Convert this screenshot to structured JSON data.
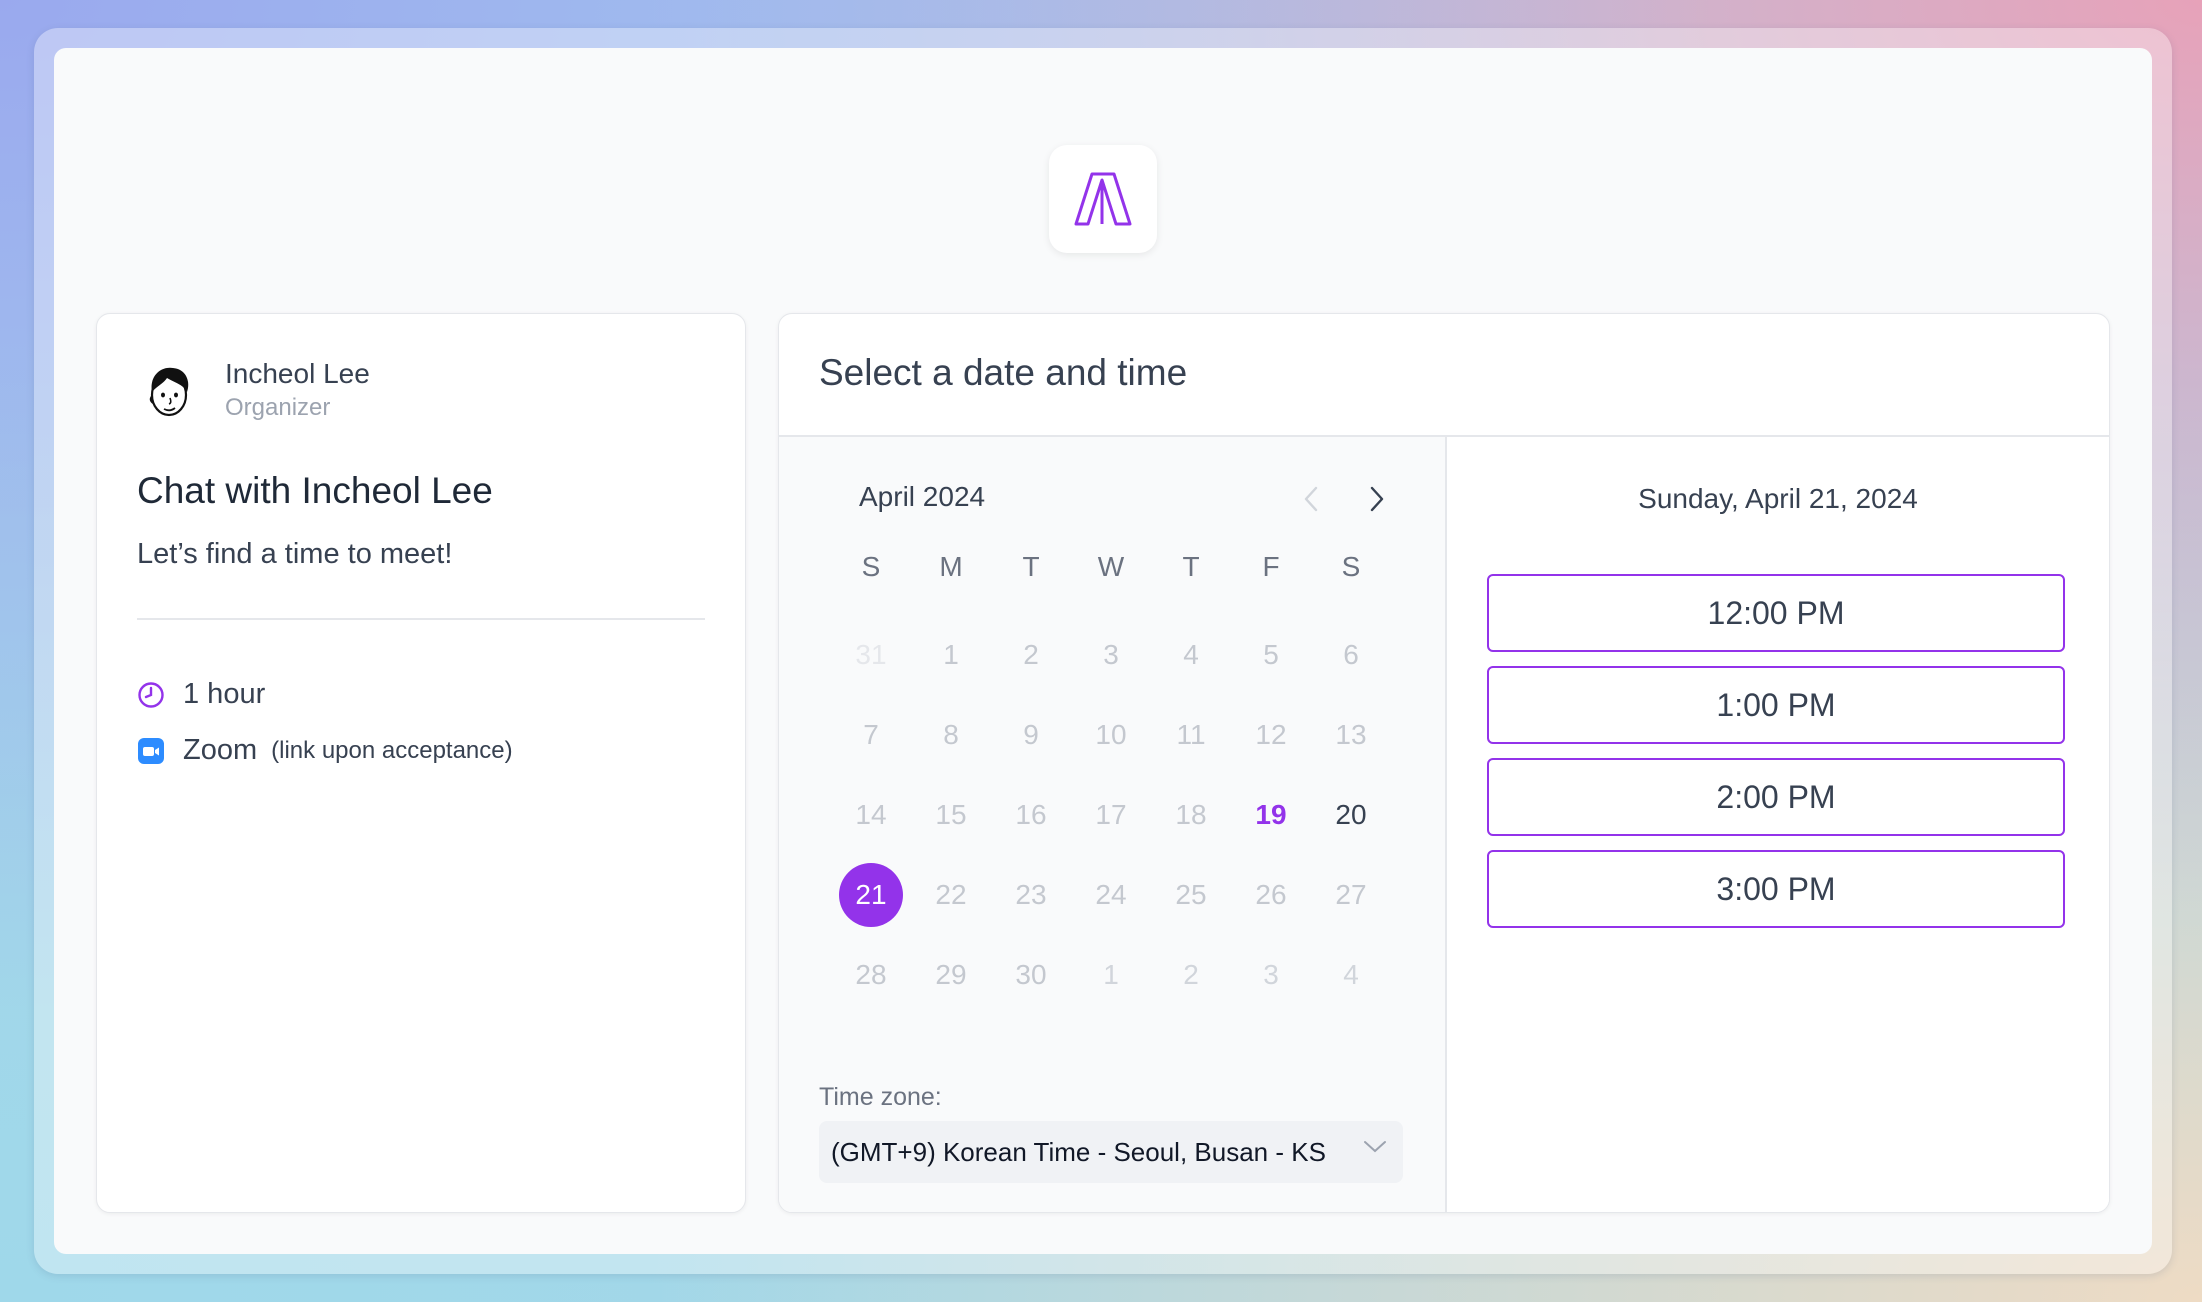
{
  "brand": {
    "accent_color": "#9333ea",
    "logo_icon": "brand-logo-icon"
  },
  "organizer": {
    "name": "Incheol Lee",
    "role": "Organizer",
    "avatar_icon": "avatar-illustration"
  },
  "event": {
    "title": "Chat with Incheol Lee",
    "description": "Let’s find a time to meet!",
    "duration": "1 hour",
    "location": "Zoom",
    "location_note": "(link upon acceptance)"
  },
  "scheduler": {
    "header": "Select a date and time",
    "month_label": "April 2024",
    "prev_icon": "chevron-left-icon",
    "next_icon": "chevron-right-icon",
    "weekdays": [
      "S",
      "M",
      "T",
      "W",
      "T",
      "F",
      "S"
    ],
    "weeks": [
      [
        {
          "d": "31",
          "s": "muted"
        },
        {
          "d": "1",
          "s": "past"
        },
        {
          "d": "2",
          "s": "past"
        },
        {
          "d": "3",
          "s": "past"
        },
        {
          "d": "4",
          "s": "past"
        },
        {
          "d": "5",
          "s": "past"
        },
        {
          "d": "6",
          "s": "past"
        }
      ],
      [
        {
          "d": "7",
          "s": "past"
        },
        {
          "d": "8",
          "s": "past"
        },
        {
          "d": "9",
          "s": "past"
        },
        {
          "d": "10",
          "s": "past"
        },
        {
          "d": "11",
          "s": "past"
        },
        {
          "d": "12",
          "s": "past"
        },
        {
          "d": "13",
          "s": "past"
        }
      ],
      [
        {
          "d": "14",
          "s": "past"
        },
        {
          "d": "15",
          "s": "past"
        },
        {
          "d": "16",
          "s": "past"
        },
        {
          "d": "17",
          "s": "past"
        },
        {
          "d": "18",
          "s": "past"
        },
        {
          "d": "19",
          "s": "today"
        },
        {
          "d": "20",
          "s": "available"
        }
      ],
      [
        {
          "d": "21",
          "s": "selected"
        },
        {
          "d": "22",
          "s": "past"
        },
        {
          "d": "23",
          "s": "past"
        },
        {
          "d": "24",
          "s": "past"
        },
        {
          "d": "25",
          "s": "past"
        },
        {
          "d": "26",
          "s": "past"
        },
        {
          "d": "27",
          "s": "past"
        }
      ],
      [
        {
          "d": "28",
          "s": "past"
        },
        {
          "d": "29",
          "s": "past"
        },
        {
          "d": "30",
          "s": "past"
        },
        {
          "d": "1",
          "s": "next-month"
        },
        {
          "d": "2",
          "s": "next-month"
        },
        {
          "d": "3",
          "s": "next-month"
        },
        {
          "d": "4",
          "s": "next-month"
        }
      ]
    ],
    "timezone_label": "Time zone:",
    "timezone_value": "(GMT+9) Korean Time - Seoul, Busan - KS",
    "selected_date_label": "Sunday, April 21, 2024",
    "time_slots": [
      "12:00 PM",
      "1:00 PM",
      "2:00 PM",
      "3:00 PM"
    ]
  }
}
